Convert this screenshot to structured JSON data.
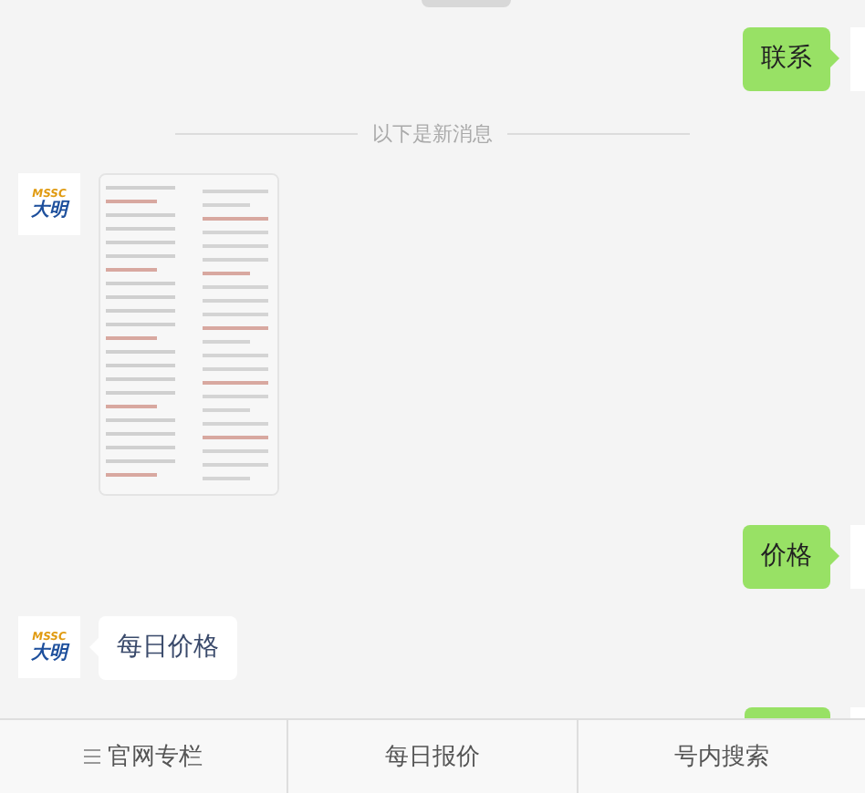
{
  "messages": [
    {
      "kind": "sent",
      "text": "联系"
    },
    {
      "kind": "divider",
      "text": "以下是新消息"
    },
    {
      "kind": "received_image",
      "avatar": {
        "brand": "MSSC",
        "name": "大明"
      }
    },
    {
      "kind": "sent",
      "text": "价格"
    },
    {
      "kind": "received",
      "text": "每日价格",
      "avatar": {
        "brand": "MSSC",
        "name": "大明"
      }
    },
    {
      "kind": "sent_cut"
    }
  ],
  "menu": [
    {
      "label": "官网专栏",
      "has_submenu": true
    },
    {
      "label": "每日报价",
      "has_submenu": false
    },
    {
      "label": "号内搜索",
      "has_submenu": false
    }
  ]
}
